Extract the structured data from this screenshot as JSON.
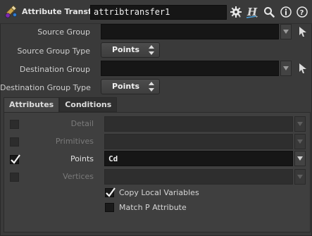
{
  "header": {
    "node_type": "Attribute Transfer",
    "node_name": "attribtransfer1",
    "icons": [
      "node-type-icon",
      "gear-icon",
      "help-h-icon",
      "search-icon",
      "info-icon",
      "help-icon"
    ]
  },
  "parameters": {
    "source_group": {
      "label": "Source Group",
      "value": ""
    },
    "source_group_type": {
      "label": "Source Group Type",
      "value": "Points"
    },
    "destination_group": {
      "label": "Destination Group",
      "value": ""
    },
    "destination_group_type": {
      "label": "Destination Group Type",
      "value": "Points"
    }
  },
  "tabs": [
    {
      "label": "Attributes",
      "active": true
    },
    {
      "label": "Conditions",
      "active": false
    }
  ],
  "attributes": {
    "detail": {
      "label": "Detail",
      "checked": false,
      "value": ""
    },
    "primitives": {
      "label": "Primitives",
      "checked": false,
      "value": ""
    },
    "points": {
      "label": "Points",
      "checked": true,
      "value": "Cd"
    },
    "vertices": {
      "label": "Vertices",
      "checked": false,
      "value": ""
    }
  },
  "options": {
    "copy_local_variables": {
      "label": "Copy Local Variables",
      "checked": true
    },
    "match_p_attribute": {
      "label": "Match P Attribute",
      "checked": false
    }
  },
  "colors": {
    "background": "#3a3a3a",
    "field": "#161616",
    "accent_blue": "#4aa3df"
  }
}
